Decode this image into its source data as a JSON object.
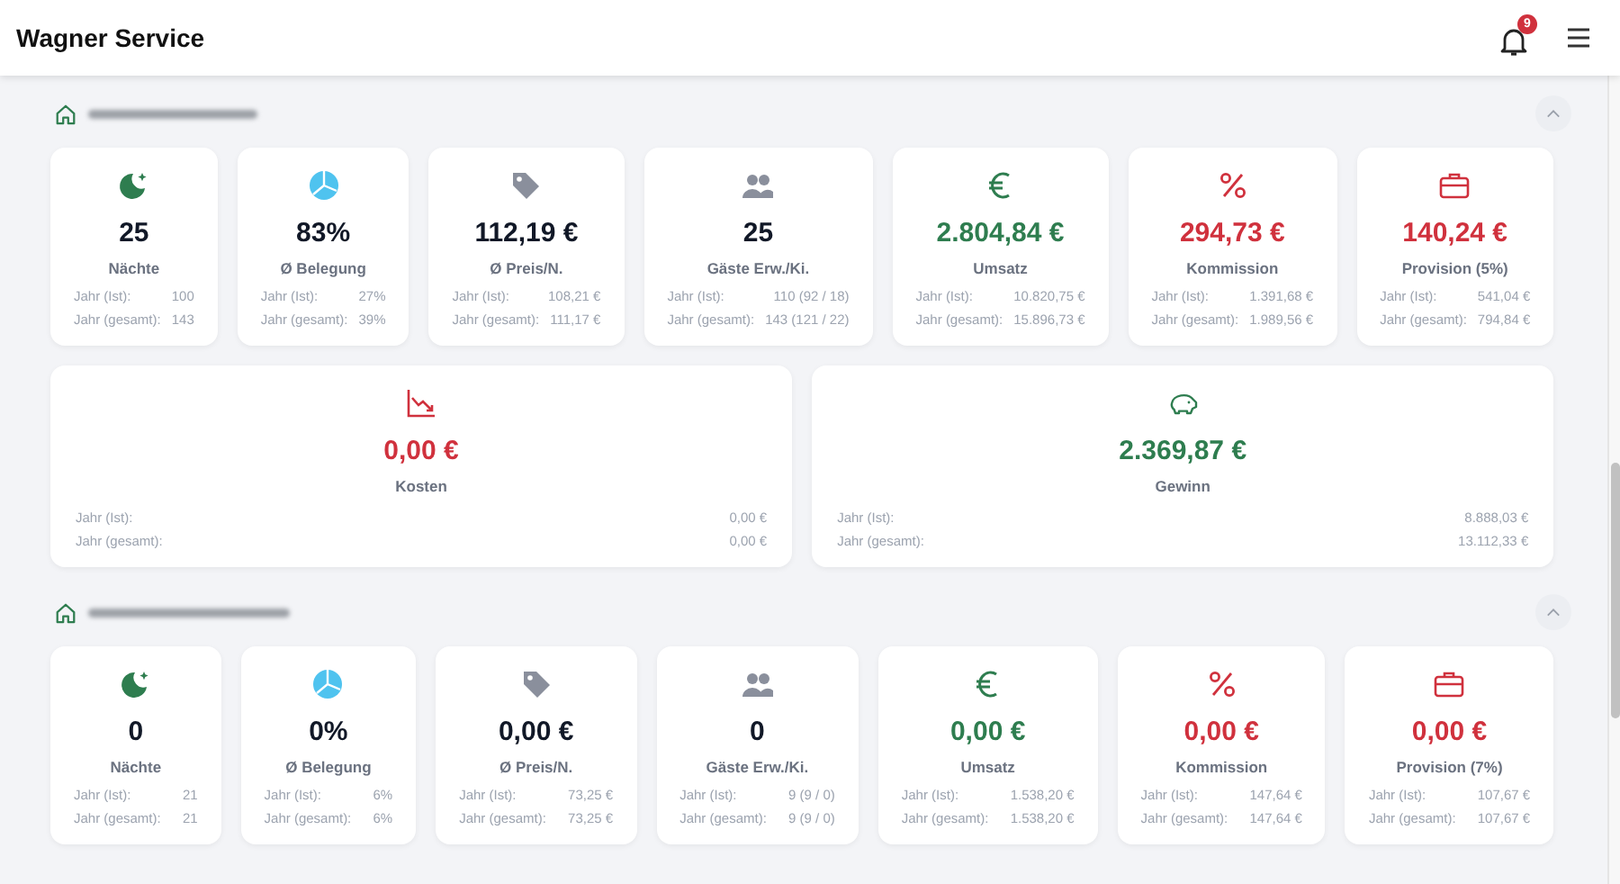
{
  "header": {
    "title": "Wagner Service",
    "notifications": "9"
  },
  "sections": [
    {
      "expanded": true,
      "cards": [
        {
          "kind": "nights",
          "value": "25",
          "label": "Nächte",
          "stats": [
            {
              "label": "Jahr (Ist):",
              "value": "100"
            },
            {
              "label": "Jahr (gesamt):",
              "value": "143"
            }
          ]
        },
        {
          "kind": "occupancy",
          "value": "83%",
          "label": "Ø Belegung",
          "stats": [
            {
              "label": "Jahr (Ist):",
              "value": "27%"
            },
            {
              "label": "Jahr (gesamt):",
              "value": "39%"
            }
          ]
        },
        {
          "kind": "price",
          "value": "112,19 €",
          "label": "Ø Preis/N.",
          "stats": [
            {
              "label": "Jahr (Ist):",
              "value": "108,21 €"
            },
            {
              "label": "Jahr (gesamt):",
              "value": "111,17 €"
            }
          ]
        },
        {
          "kind": "guests",
          "value": "25",
          "label": "Gäste Erw./Ki.",
          "stats": [
            {
              "label": "Jahr (Ist):",
              "value": "110 (92 / 18)"
            },
            {
              "label": "Jahr (gesamt):",
              "value": "143 (121 / 22)"
            }
          ]
        },
        {
          "kind": "revenue",
          "value": "2.804,84 €",
          "label": "Umsatz",
          "stats": [
            {
              "label": "Jahr (Ist):",
              "value": "10.820,75 €"
            },
            {
              "label": "Jahr (gesamt):",
              "value": "15.896,73 €"
            }
          ]
        },
        {
          "kind": "commission",
          "value": "294,73 €",
          "label": "Kommission",
          "stats": [
            {
              "label": "Jahr (Ist):",
              "value": "1.391,68 €"
            },
            {
              "label": "Jahr (gesamt):",
              "value": "1.989,56 €"
            }
          ]
        },
        {
          "kind": "provision",
          "value": "140,24 €",
          "label": "Provision (5%)",
          "stats": [
            {
              "label": "Jahr (Ist):",
              "value": "541,04 €"
            },
            {
              "label": "Jahr (gesamt):",
              "value": "794,84 €"
            }
          ]
        }
      ],
      "wide_cards": [
        {
          "kind": "costs",
          "value": "0,00 €",
          "label": "Kosten",
          "stats": [
            {
              "label": "Jahr (Ist):",
              "value": "0,00 €"
            },
            {
              "label": "Jahr (gesamt):",
              "value": "0,00 €"
            }
          ]
        },
        {
          "kind": "profit",
          "value": "2.369,87 €",
          "label": "Gewinn",
          "stats": [
            {
              "label": "Jahr (Ist):",
              "value": "8.888,03 €"
            },
            {
              "label": "Jahr (gesamt):",
              "value": "13.112,33 €"
            }
          ]
        }
      ]
    },
    {
      "expanded": true,
      "cards": [
        {
          "kind": "nights",
          "value": "0",
          "label": "Nächte",
          "stats": [
            {
              "label": "Jahr (Ist):",
              "value": "21"
            },
            {
              "label": "Jahr (gesamt):",
              "value": "21"
            }
          ]
        },
        {
          "kind": "occupancy",
          "value": "0%",
          "label": "Ø Belegung",
          "stats": [
            {
              "label": "Jahr (Ist):",
              "value": "6%"
            },
            {
              "label": "Jahr (gesamt):",
              "value": "6%"
            }
          ]
        },
        {
          "kind": "price",
          "value": "0,00 €",
          "label": "Ø Preis/N.",
          "stats": [
            {
              "label": "Jahr (Ist):",
              "value": "73,25 €"
            },
            {
              "label": "Jahr (gesamt):",
              "value": "73,25 €"
            }
          ]
        },
        {
          "kind": "guests",
          "value": "0",
          "label": "Gäste Erw./Ki.",
          "stats": [
            {
              "label": "Jahr (Ist):",
              "value": "9 (9 / 0)"
            },
            {
              "label": "Jahr (gesamt):",
              "value": "9 (9 / 0)"
            }
          ]
        },
        {
          "kind": "revenue",
          "value": "0,00 €",
          "label": "Umsatz",
          "stats": [
            {
              "label": "Jahr (Ist):",
              "value": "1.538,20 €"
            },
            {
              "label": "Jahr (gesamt):",
              "value": "1.538,20 €"
            }
          ]
        },
        {
          "kind": "commission",
          "value": "0,00 €",
          "label": "Kommission",
          "stats": [
            {
              "label": "Jahr (Ist):",
              "value": "147,64 €"
            },
            {
              "label": "Jahr (gesamt):",
              "value": "147,64 €"
            }
          ]
        },
        {
          "kind": "provision",
          "value": "0,00 €",
          "label": "Provision (7%)",
          "stats": [
            {
              "label": "Jahr (Ist):",
              "value": "107,67 €"
            },
            {
              "label": "Jahr (gesamt):",
              "value": "107,67 €"
            }
          ]
        }
      ]
    }
  ]
}
